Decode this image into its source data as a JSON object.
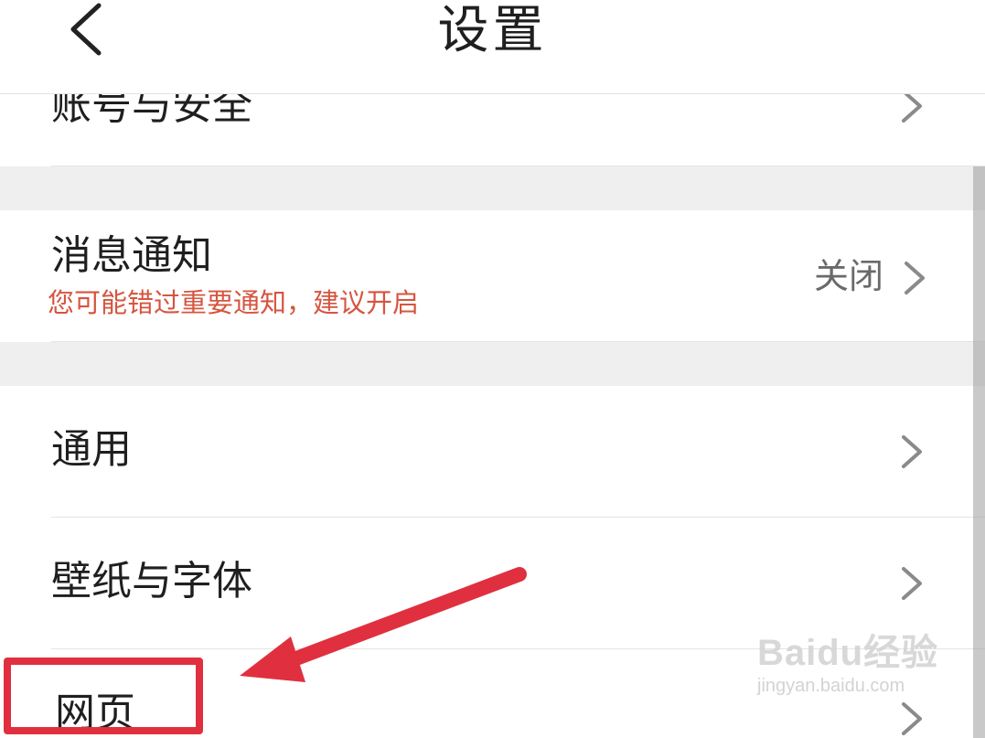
{
  "header": {
    "title": "设置",
    "back_icon": "chevron-left-icon"
  },
  "rows": {
    "account": {
      "label": "账号与安全"
    },
    "notifications": {
      "label": "消息通知",
      "hint": "您可能错过重要通知，建议开启",
      "value": "关闭"
    },
    "general": {
      "label": "通用"
    },
    "wallpaper": {
      "label": "壁纸与字体"
    },
    "webpage": {
      "label": "网页"
    }
  },
  "colors": {
    "hint_text": "#d6553f",
    "annotation": "#e0303f",
    "section_gap": "#efefef"
  },
  "watermark": {
    "logo": "Baidu经验",
    "url": "jingyan.baidu.com"
  }
}
